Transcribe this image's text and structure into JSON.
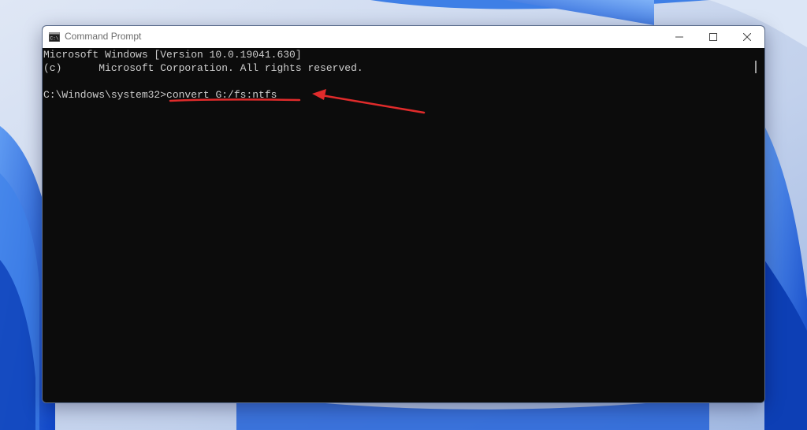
{
  "window": {
    "title": "Command Prompt",
    "minimize_label": "Minimize",
    "maximize_label": "Maximize",
    "close_label": "Close"
  },
  "console": {
    "lines": [
      "Microsoft Windows [Version 10.0.19041.630]",
      "(c)      Microsoft Corporation. All rights reserved."
    ],
    "prompt": "C:\\Windows\\system32>",
    "command": "convert G:/fs:ntfs"
  },
  "colors": {
    "console_background": "#0c0c0c",
    "console_text": "#cccccc",
    "annotation_red": "#e02b2b",
    "wallpaper_blue": "#1d5fd6"
  },
  "icons": {
    "app": "cmd-icon",
    "minimize": "minimize-icon",
    "maximize": "maximize-icon",
    "close": "close-icon",
    "annotation": "red-arrow-icon"
  }
}
